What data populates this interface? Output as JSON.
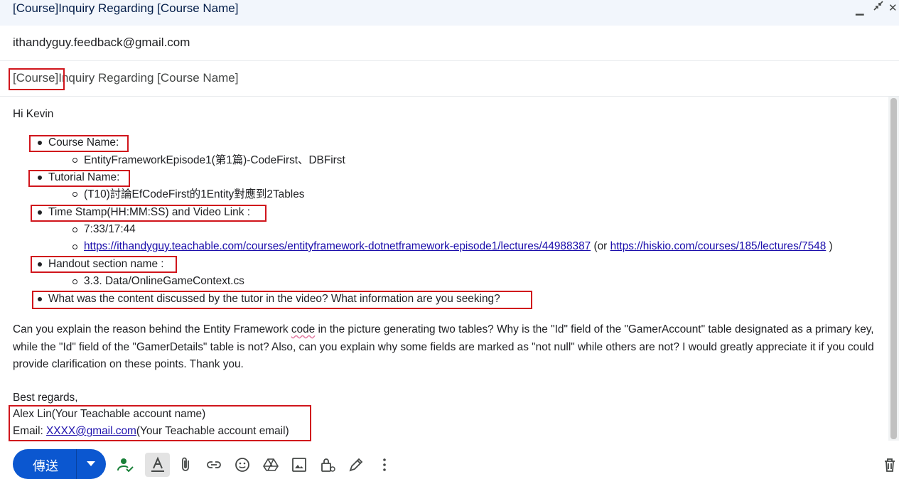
{
  "window": {
    "title": "[Course]Inquiry Regarding [Course Name]"
  },
  "recipients": {
    "to": "ithandyguy.feedback@gmail.com"
  },
  "subject": {
    "prefix": "[Course]",
    "rest": "Inquiry Regarding [Course Name]"
  },
  "body": {
    "greeting": "Hi Kevin",
    "items": [
      {
        "label": "Course Name:",
        "sub": "EntityFrameworkEpisode1(第1篇)-CodeFirst、DBFirst"
      },
      {
        "label": "Tutorial Name:",
        "sub": "(T10)討論EfCodeFirst的1Entity對應到2Tables"
      },
      {
        "label": "Time Stamp(HH:MM:SS) and Video Link :",
        "sub": "7:33/17:44",
        "link1": "https://ithandyguy.teachable.com/courses/entityframework-dotnetframework-episode1/lectures/44988387",
        "link_mid": " (or ",
        "link2": "https://hiskio.com/courses/185/lectures/7548",
        "link_end": " )"
      },
      {
        "label": "Handout section name :",
        "sub": "3.3. Data/OnlineGameContext.cs"
      },
      {
        "label": "What was the content discussed by the tutor in the video? What information are you seeking?"
      }
    ],
    "para_before": "Can you explain the reason behind the Entity Framework ",
    "para_code": "code",
    "para_after": " in the picture generating two tables? Why is the \"Id\" field of the \"GamerAccount\" table designated as a primary key, while the \"Id\" field of the \"GamerDetails\" table is not? Also, can you explain why some fields are marked as \"not null\" while others are not? I would greatly appreciate it if you could provide clarification on these points. Thank you.",
    "closing": "Best regards,",
    "signature_name": "Alex Lin(Your Teachable account name)",
    "email_label": "Email: ",
    "email_link": "XXXX@gmail.com",
    "email_suffix": "(Your Teachable account email)"
  },
  "toolbar": {
    "send_label": "傳送"
  },
  "colors": {
    "highlight_box": "#d0151c",
    "send_button": "#0b57d0",
    "link": "#1a0dab"
  }
}
